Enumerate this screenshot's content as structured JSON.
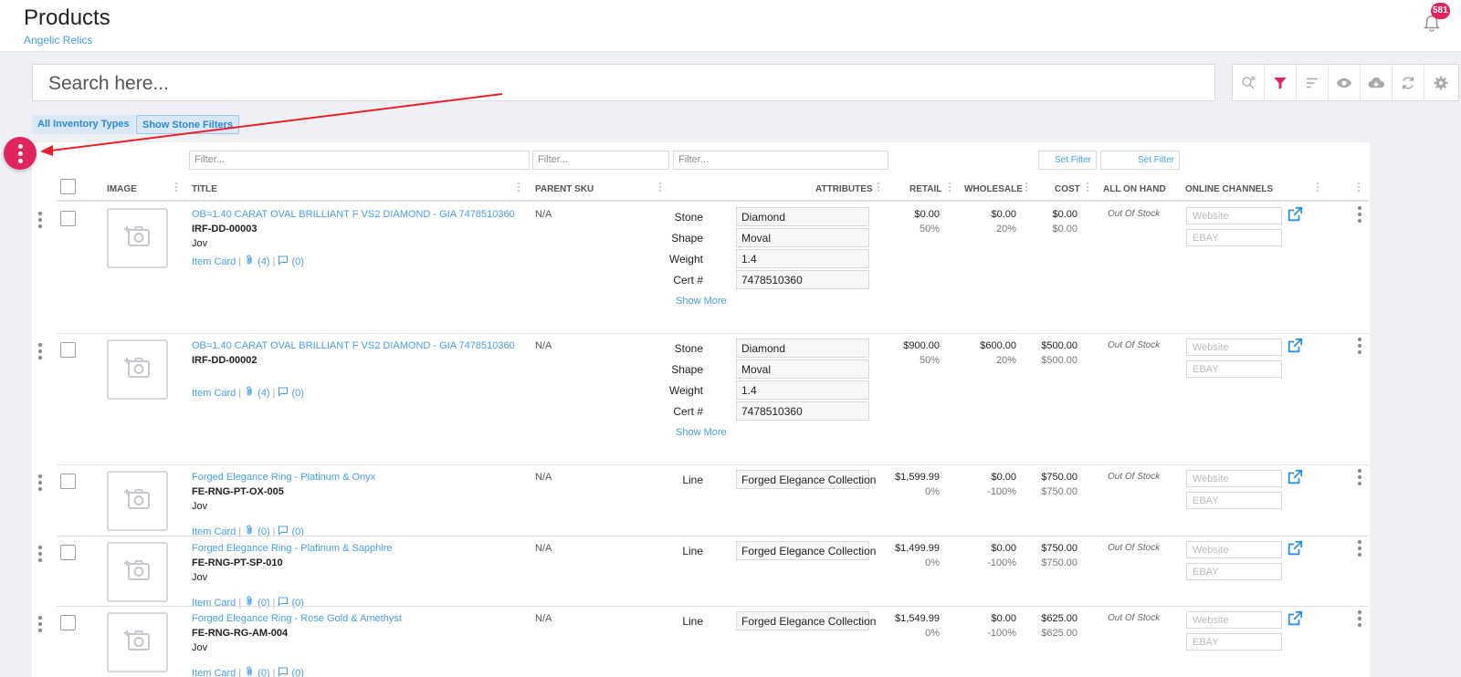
{
  "header": {
    "title": "Products",
    "subtitle": "Angelic Relics",
    "notification_count": "581"
  },
  "search": {
    "placeholder": "Search here..."
  },
  "toolbar": [
    "search-settings-icon",
    "filter-icon",
    "sort-icon",
    "eye-icon",
    "cloud-download-icon",
    "refresh-icon",
    "gear-icon"
  ],
  "chips": {
    "inventory_types": "All Inventory Types",
    "stone_filters": "Show Stone Filters"
  },
  "filters": {
    "placeholder": "Filter...",
    "set_filter": "Set Filter"
  },
  "columns": {
    "image": "IMAGE",
    "title": "TITLE",
    "parent_sku": "PARENT SKU",
    "attributes": "ATTRIBUTES",
    "retail": "RETAIL",
    "wholesale": "WHOLESALE",
    "cost": "COST",
    "on_hand": "ALL ON HAND",
    "channels": "ONLINE CHANNELS"
  },
  "labels": {
    "item_card": "Item Card",
    "show_more": "Show More",
    "website": "Website",
    "ebay": "EBAY"
  },
  "rows": [
    {
      "title": "OB=1.40 CARAT OVAL BRILLIANT F VS2 DIAMOND - GIA 7478510360",
      "sku": "IRF-DD-00003",
      "vendor": "Jov",
      "attachments": "(4)",
      "comments": "(0)",
      "parent_sku": "N/A",
      "attributes": [
        {
          "label": "Stone",
          "value": "Diamond"
        },
        {
          "label": "Shape",
          "value": "Moval"
        },
        {
          "label": "Weight",
          "value": "1.4"
        },
        {
          "label": "Cert #",
          "value": "7478510360"
        }
      ],
      "retail": "$0.00",
      "retail_pct": "50%",
      "wholesale": "$0.00",
      "wholesale_pct": "20%",
      "cost": "$0.00",
      "cost_sub": "$0.00",
      "stock": "Out Of Stock"
    },
    {
      "title": "OB=1.40 CARAT OVAL BRILLIANT F VS2 DIAMOND - GIA 7478510360",
      "sku": "IRF-DD-00002",
      "vendor": "",
      "attachments": "(4)",
      "comments": "(0)",
      "parent_sku": "N/A",
      "attributes": [
        {
          "label": "Stone",
          "value": "Diamond"
        },
        {
          "label": "Shape",
          "value": "Moval"
        },
        {
          "label": "Weight",
          "value": "1.4"
        },
        {
          "label": "Cert #",
          "value": "7478510360"
        }
      ],
      "retail": "$900.00",
      "retail_pct": "50%",
      "wholesale": "$600.00",
      "wholesale_pct": "20%",
      "cost": "$500.00",
      "cost_sub": "$500.00",
      "stock": "Out Of Stock"
    },
    {
      "title": "Forged Elegance Ring - Platinum & Onyx",
      "sku": "FE-RNG-PT-OX-005",
      "vendor": "Jov",
      "attachments": "(0)",
      "comments": "(0)",
      "parent_sku": "N/A",
      "attributes": [
        {
          "label": "Line",
          "value": "Forged Elegance Collection"
        }
      ],
      "retail": "$1,599.99",
      "retail_pct": "0%",
      "wholesale": "$0.00",
      "wholesale_pct": "-100%",
      "cost": "$750.00",
      "cost_sub": "$750.00",
      "stock": "Out Of Stock"
    },
    {
      "title": "Forged Elegance Ring - Platinum & Sapphire",
      "sku": "FE-RNG-PT-SP-010",
      "vendor": "Jov",
      "attachments": "(0)",
      "comments": "(0)",
      "parent_sku": "N/A",
      "attributes": [
        {
          "label": "Line",
          "value": "Forged Elegance Collection"
        }
      ],
      "retail": "$1,499.99",
      "retail_pct": "0%",
      "wholesale": "$0.00",
      "wholesale_pct": "-100%",
      "cost": "$750.00",
      "cost_sub": "$750.00",
      "stock": "Out Of Stock"
    },
    {
      "title": "Forged Elegance Ring - Rose Gold & Amethyst",
      "sku": "FE-RNG-RG-AM-004",
      "vendor": "Jov",
      "attachments": "(0)",
      "comments": "(0)",
      "parent_sku": "N/A",
      "attributes": [
        {
          "label": "Line",
          "value": "Forged Elegance Collection"
        }
      ],
      "retail": "$1,549.99",
      "retail_pct": "0%",
      "wholesale": "$0.00",
      "wholesale_pct": "-100%",
      "cost": "$625.00",
      "cost_sub": "$625.00",
      "stock": "Out Of Stock"
    }
  ],
  "colors": {
    "accent": "#e0245e",
    "link": "#4a9ee8",
    "annotation_arrow": "#e8202a"
  }
}
